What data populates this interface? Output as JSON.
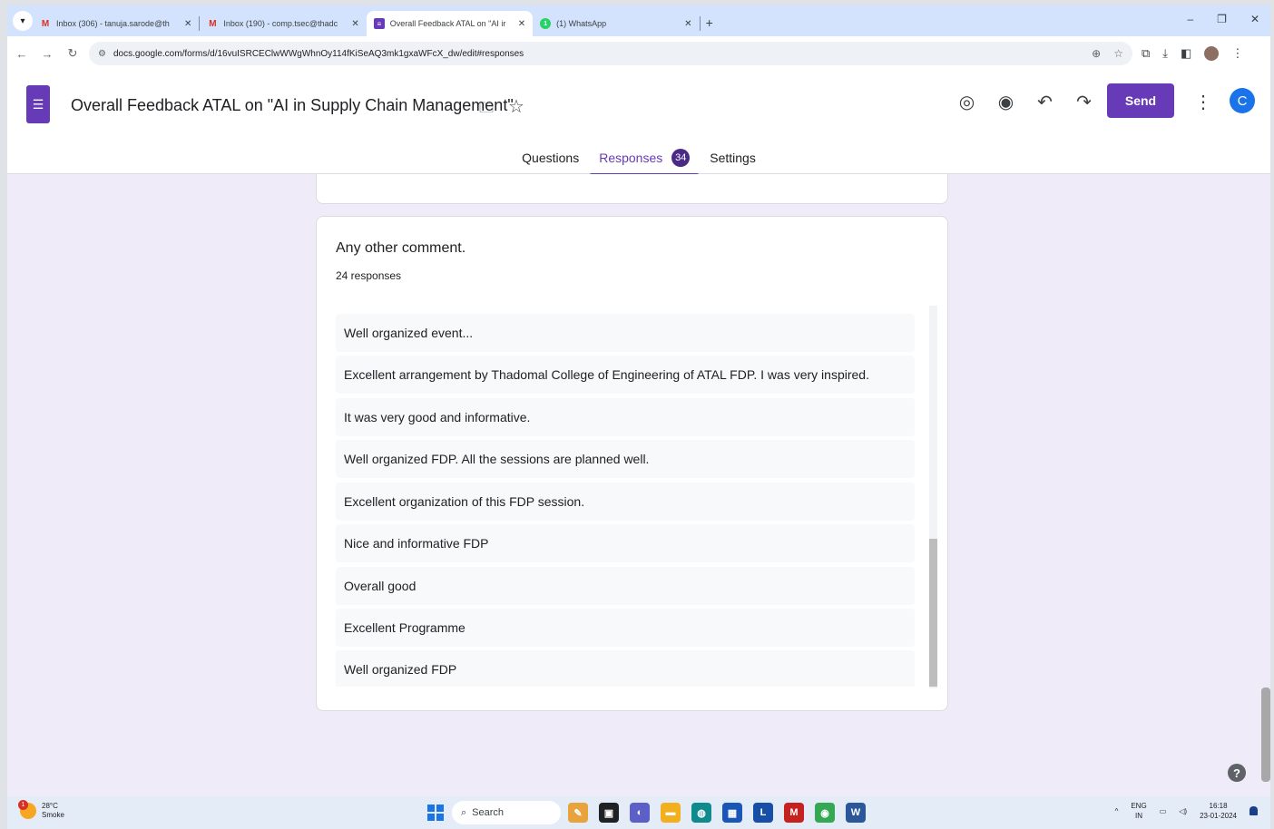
{
  "browser": {
    "tabs": [
      {
        "title": "Inbox (306) - tanuja.sarode@th",
        "favicon": "gmail-icon",
        "active": false
      },
      {
        "title": "Inbox (190) - comp.tsec@thadc",
        "favicon": "gmail-icon",
        "active": false
      },
      {
        "title": "Overall Feedback ATAL on \"AI ir",
        "favicon": "forms-icon",
        "active": true
      },
      {
        "title": "(1) WhatsApp",
        "favicon": "whatsapp-icon",
        "active": false
      }
    ],
    "url": "docs.google.com/forms/d/16vuISRCEClwWWgWhnOy114fKiSeAQ3mk1gxaWFcX_dw/edit#responses"
  },
  "form": {
    "title": "Overall Feedback ATAL on \"AI in Supply Chain Management\"",
    "send_label": "Send",
    "avatar_letter": "C",
    "tabs": [
      {
        "label": "Questions"
      },
      {
        "label": "Responses",
        "badge": "34"
      },
      {
        "label": "Settings"
      }
    ],
    "accent_color": "#673ab7"
  },
  "question": {
    "title": "Any other comment.",
    "count_label": "24 responses",
    "responses": [
      "Well organized event...",
      "Excellent arrangement by Thadomal College of Engineering of ATAL FDP. I was very inspired.",
      "It was very good and informative.",
      "Well organized FDP. All the sessions are planned well.",
      "Excellent organization of this FDP session.",
      "Nice and informative FDP",
      "Overall good",
      "Excellent Programme",
      "Well organized FDP"
    ]
  },
  "taskbar": {
    "weather_temp": "28°C",
    "weather_desc": "Smoke",
    "weather_badge": "1",
    "search_placeholder": "Search",
    "lang_top": "ENG",
    "lang_bottom": "IN",
    "time": "16:18",
    "date": "23-01-2024"
  }
}
